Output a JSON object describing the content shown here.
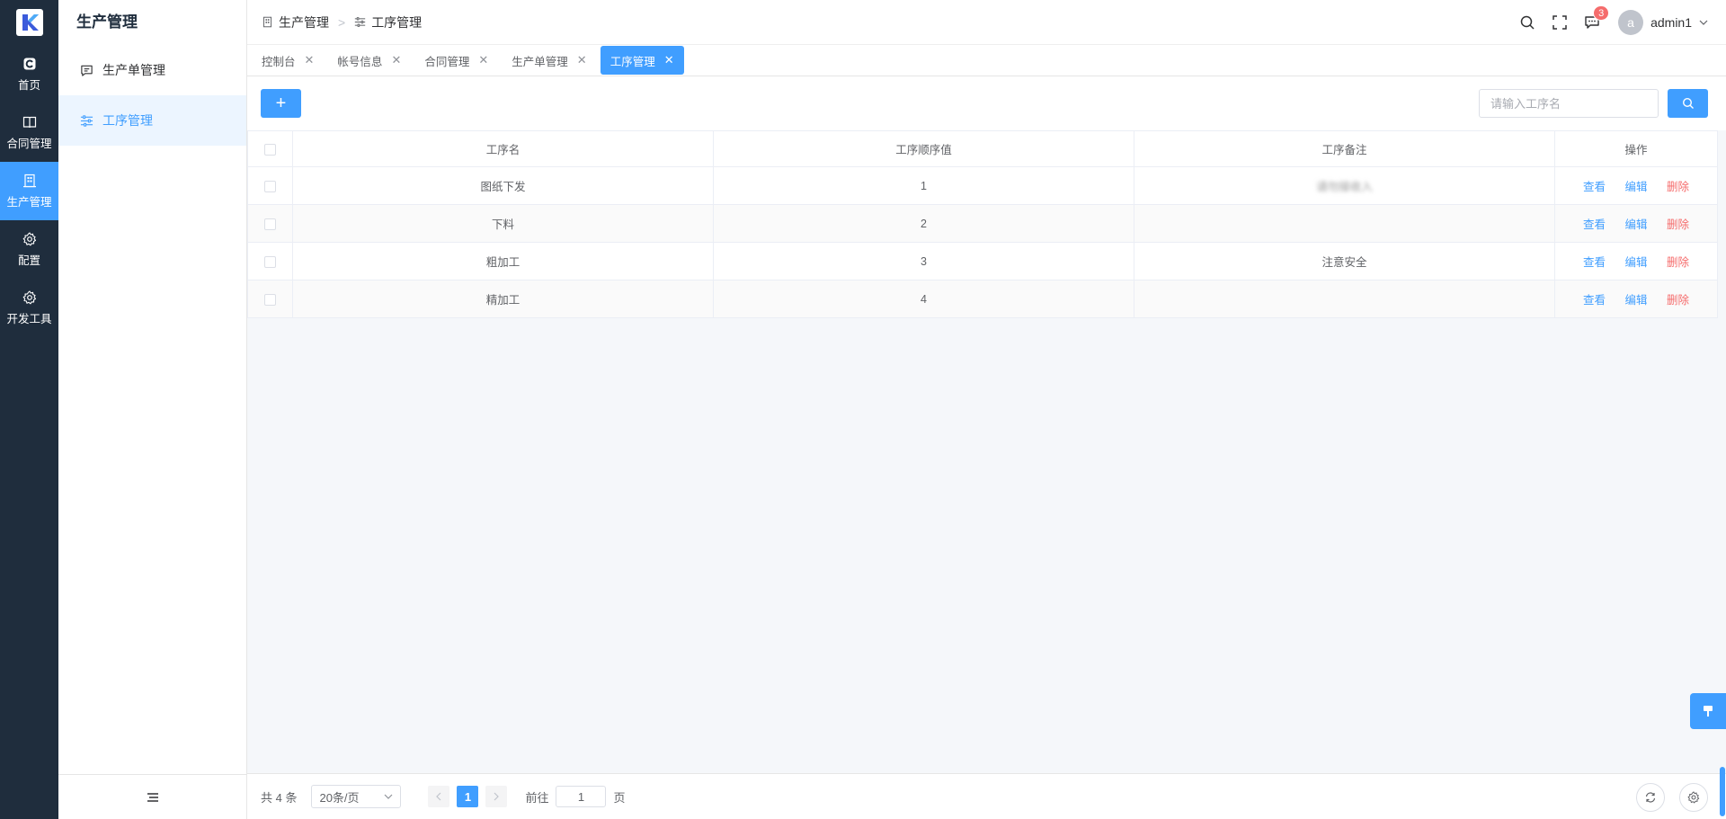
{
  "rail": {
    "items": [
      {
        "label": "首页",
        "icon": "home-icon"
      },
      {
        "label": "合同管理",
        "icon": "book-icon"
      },
      {
        "label": "生产管理",
        "icon": "building-icon",
        "active": true
      },
      {
        "label": "配置",
        "icon": "gear-icon"
      },
      {
        "label": "开发工具",
        "icon": "gear-icon"
      }
    ]
  },
  "submenu": {
    "title": "生产管理",
    "items": [
      {
        "label": "生产单管理",
        "icon": "message-icon"
      },
      {
        "label": "工序管理",
        "icon": "sliders-icon",
        "active": true
      }
    ]
  },
  "header": {
    "breadcrumb": [
      {
        "label": "生产管理",
        "icon": "building-icon"
      },
      {
        "label": "工序管理",
        "icon": "sliders-icon"
      }
    ],
    "notifications": "3",
    "avatar_letter": "a",
    "username": "admin1"
  },
  "tabs": [
    {
      "label": "控制台"
    },
    {
      "label": "帐号信息"
    },
    {
      "label": "合同管理"
    },
    {
      "label": "生产单管理"
    },
    {
      "label": "工序管理",
      "active": true
    }
  ],
  "toolbar": {
    "add_label": "+",
    "search_placeholder": "请输入工序名"
  },
  "table": {
    "columns": [
      "工序名",
      "工序顺序值",
      "工序备注",
      "操作"
    ],
    "rows": [
      {
        "name": "图纸下发",
        "order": "1",
        "note": "请勿接收入"
      },
      {
        "name": "下料",
        "order": "2",
        "note": ""
      },
      {
        "name": "粗加工",
        "order": "3",
        "note": "注意安全"
      },
      {
        "name": "精加工",
        "order": "4",
        "note": ""
      }
    ],
    "actions": {
      "view": "查看",
      "edit": "编辑",
      "delete": "删除"
    }
  },
  "pagination": {
    "total": "共 4 条",
    "page_size": "20条/页",
    "current_page": "1",
    "goto_label": "前往",
    "goto_value": "1",
    "page_suffix": "页"
  },
  "colors": {
    "primary": "#409eff",
    "danger": "#f56c6c",
    "rail_bg": "#1f2d3d"
  }
}
